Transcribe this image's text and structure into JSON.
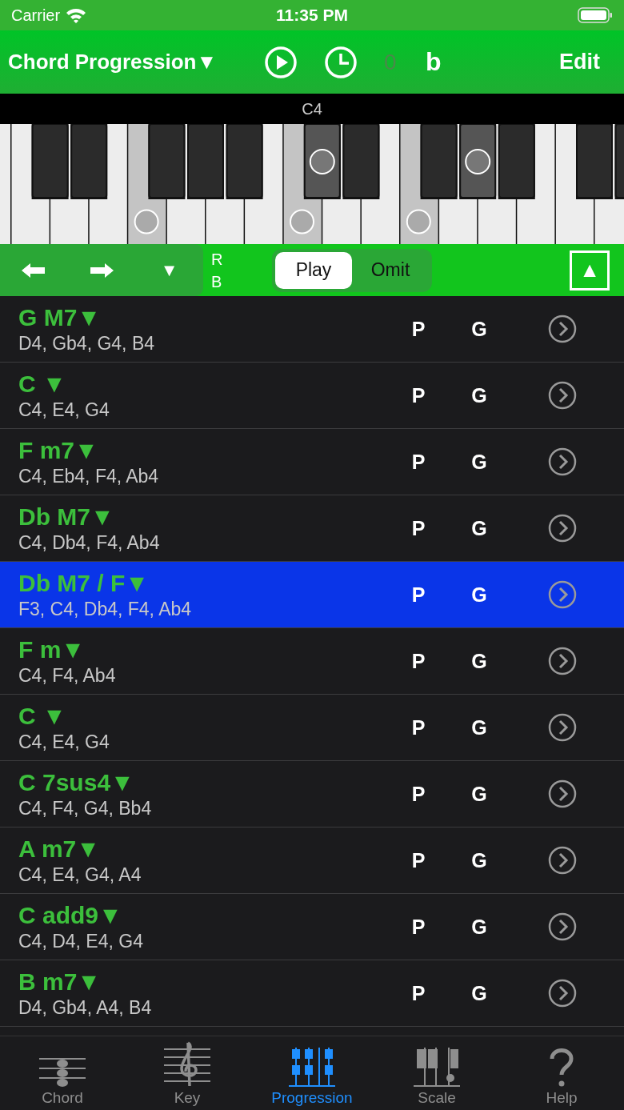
{
  "status_bar": {
    "carrier": "Carrier",
    "time": "11:35 PM"
  },
  "nav": {
    "title": "Chord Progression▼",
    "counter": "0",
    "counter_disabled": true,
    "accidental": "b",
    "edit": "Edit"
  },
  "keyboard": {
    "label": "C4",
    "white_keys": [
      {
        "marked": false
      },
      {
        "marked": false
      },
      {
        "marked": false
      },
      {
        "marked": false
      },
      {
        "marked": true
      },
      {
        "marked": false
      },
      {
        "marked": false
      },
      {
        "marked": false
      },
      {
        "marked": true
      },
      {
        "marked": false
      },
      {
        "marked": false
      },
      {
        "marked": true
      },
      {
        "marked": false
      },
      {
        "marked": false
      },
      {
        "marked": false
      },
      {
        "marked": false
      },
      {
        "marked": false
      }
    ],
    "black_keys": [
      {
        "marked": false
      },
      {
        "marked": false
      },
      {
        "marked": false
      },
      {
        "marked": false
      },
      {
        "marked": false
      },
      {
        "marked": true
      },
      {
        "marked": false
      },
      {
        "marked": false
      },
      {
        "marked": true
      },
      {
        "marked": false
      },
      {
        "marked": false
      },
      {
        "marked": false
      }
    ]
  },
  "controls": {
    "down": "▼",
    "r": "R",
    "b": "B",
    "segments": [
      {
        "label": "Play",
        "selected": true
      },
      {
        "label": "Omit",
        "selected": false
      }
    ],
    "up": "▲"
  },
  "rows": [
    {
      "chord": "G M7▼",
      "notes": "D4, Gb4, G4, B4",
      "p": "P",
      "g": "G",
      "selected": false
    },
    {
      "chord": "C ▼",
      "notes": "C4, E4, G4",
      "p": "P",
      "g": "G",
      "selected": false
    },
    {
      "chord": "F m7▼",
      "notes": "C4, Eb4, F4, Ab4",
      "p": "P",
      "g": "G",
      "selected": false
    },
    {
      "chord": "Db M7▼",
      "notes": "C4, Db4, F4, Ab4",
      "p": "P",
      "g": "G",
      "selected": false
    },
    {
      "chord": "Db M7 / F▼",
      "notes": "F3, C4, Db4, F4, Ab4",
      "p": "P",
      "g": "G",
      "selected": true
    },
    {
      "chord": "F m▼",
      "notes": "C4, F4, Ab4",
      "p": "P",
      "g": "G",
      "selected": false
    },
    {
      "chord": "C ▼",
      "notes": "C4, E4, G4",
      "p": "P",
      "g": "G",
      "selected": false
    },
    {
      "chord": "C 7sus4▼",
      "notes": "C4, F4, G4, Bb4",
      "p": "P",
      "g": "G",
      "selected": false
    },
    {
      "chord": "A m7▼",
      "notes": "C4, E4, G4, A4",
      "p": "P",
      "g": "G",
      "selected": false
    },
    {
      "chord": "C add9▼",
      "notes": "C4, D4, E4, G4",
      "p": "P",
      "g": "G",
      "selected": false
    },
    {
      "chord": "B m7▼",
      "notes": "D4, Gb4, A4, B4",
      "p": "P",
      "g": "G",
      "selected": false
    }
  ],
  "tabs": [
    {
      "label": "Chord",
      "kind": "chord",
      "selected": false
    },
    {
      "label": "Key",
      "kind": "key",
      "selected": false
    },
    {
      "label": "Progression",
      "kind": "progression",
      "selected": true
    },
    {
      "label": "Scale",
      "kind": "scale",
      "selected": false
    },
    {
      "label": "Help",
      "kind": "help",
      "selected": false
    }
  ]
}
